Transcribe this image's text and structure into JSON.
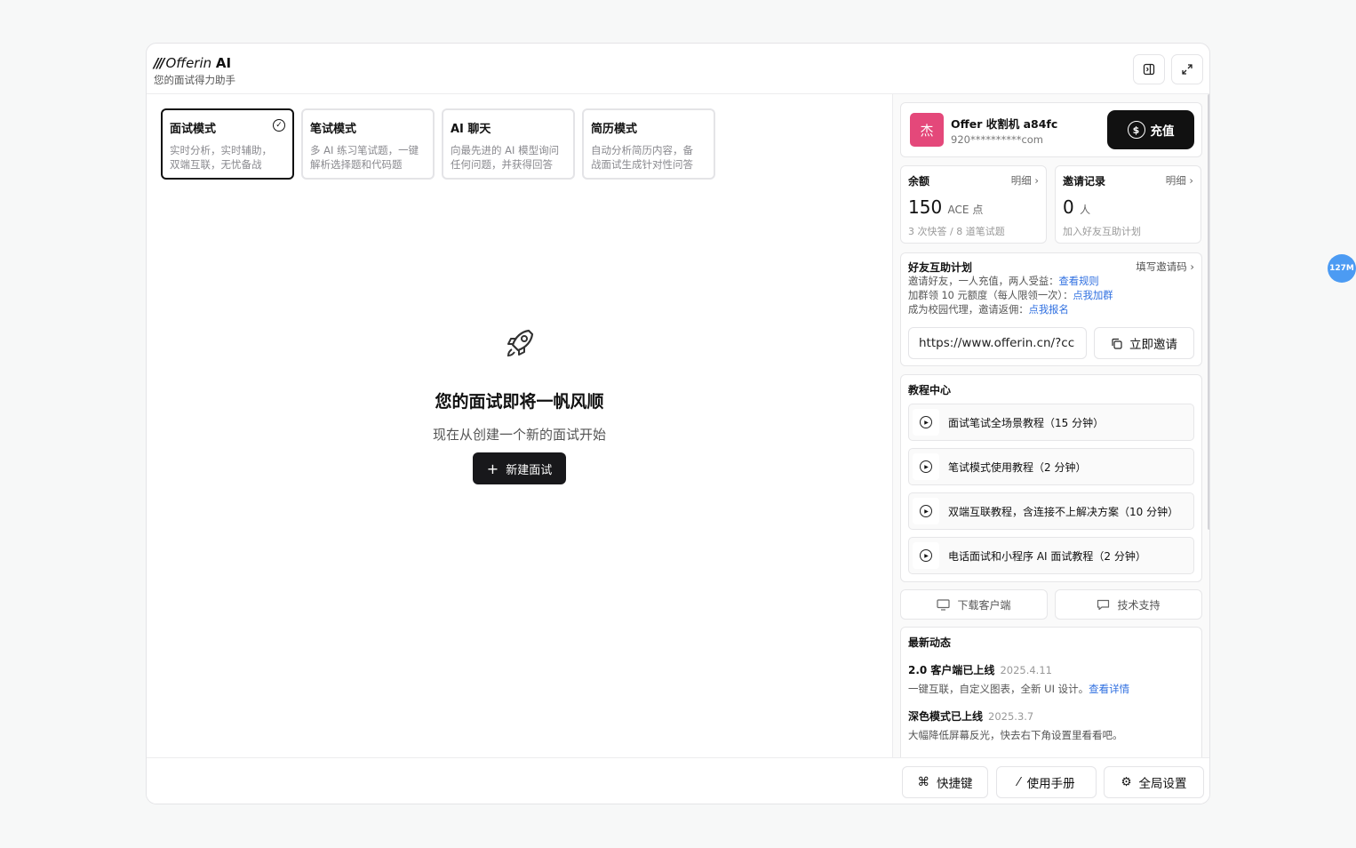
{
  "header": {
    "logo_mark": "///",
    "app_name_prefix": "Offerin",
    "app_name_suffix": "AI",
    "tagline": "您的面试得力助手"
  },
  "modes": [
    {
      "title": "面试模式",
      "desc_line1": "实时分析，实时辅助，",
      "desc_line2": "双端互联，无忧备战",
      "active": true
    },
    {
      "title": "笔试模式",
      "desc_line1": "多 AI 练习笔试题，一键",
      "desc_line2": "解析选择题和代码题",
      "active": false
    },
    {
      "title": "AI 聊天",
      "desc_line1": "向最先进的 AI 模型询问",
      "desc_line2": "任何问题，并获得回答",
      "active": false
    },
    {
      "title": "简历模式",
      "desc_line1": "自动分析简历内容，备",
      "desc_line2": "战面试生成针对性问答",
      "active": false
    }
  ],
  "empty_state": {
    "title": "您的面试即将一帆风顺",
    "subtitle": "现在从创建一个新的面试开始",
    "button": "新建面试"
  },
  "user": {
    "avatar_char": "杰",
    "name": "Offer 收割机 a84fc",
    "email": "920**********com",
    "recharge_label": "充值"
  },
  "balance": {
    "label": "余额",
    "detail": "明细",
    "value": "150",
    "unit": "ACE 点",
    "note": "3 次快答 / 8 道笔试题"
  },
  "invites": {
    "label": "邀请记录",
    "detail": "明细",
    "value": "0",
    "unit": "人",
    "note": "加入好友互助计划"
  },
  "referral": {
    "title": "好友互助计划",
    "fill_code": "填写邀请码",
    "line1_text": "邀请好友，一人充值，两人受益：",
    "line1_link": "查看规则",
    "line2_text": "加群领 10 元额度（每人限领一次）：",
    "line2_link": "点我加群",
    "line3_text": "成为校园代理，邀请返佣：",
    "line3_link": "点我报名",
    "url": "https://www.offerin.cn/?cc",
    "invite_button": "立即邀请"
  },
  "tutorials": {
    "title": "教程中心",
    "items": [
      "面试笔试全场景教程（15 分钟）",
      "笔试模式使用教程（2 分钟）",
      "双端互联教程，含连接不上解决方案（10 分钟）",
      "电话面试和小程序 AI 面试教程（2 分钟）"
    ]
  },
  "actions": {
    "download": "下载客户端",
    "support": "技术支持"
  },
  "news": {
    "title": "最新动态",
    "items": [
      {
        "title": "2.0 客户端已上线",
        "date": "2025.4.11",
        "body": "一键互联，自定义图表，全新 UI 设计。",
        "link": "查看详情"
      },
      {
        "title": "深色模式已上线",
        "date": "2025.3.7",
        "body": "大幅降低屏幕反光，快去右下角设置里看看吧。",
        "link": ""
      }
    ]
  },
  "footer": {
    "shortcuts": "快捷键",
    "manual": "使用手册",
    "settings": "全局设置"
  },
  "memory_badge": "127M",
  "colors": {
    "accent": "#111111",
    "link": "#2f6fe0",
    "avatar": "#e4487a",
    "badge": "#4c9bf3"
  }
}
